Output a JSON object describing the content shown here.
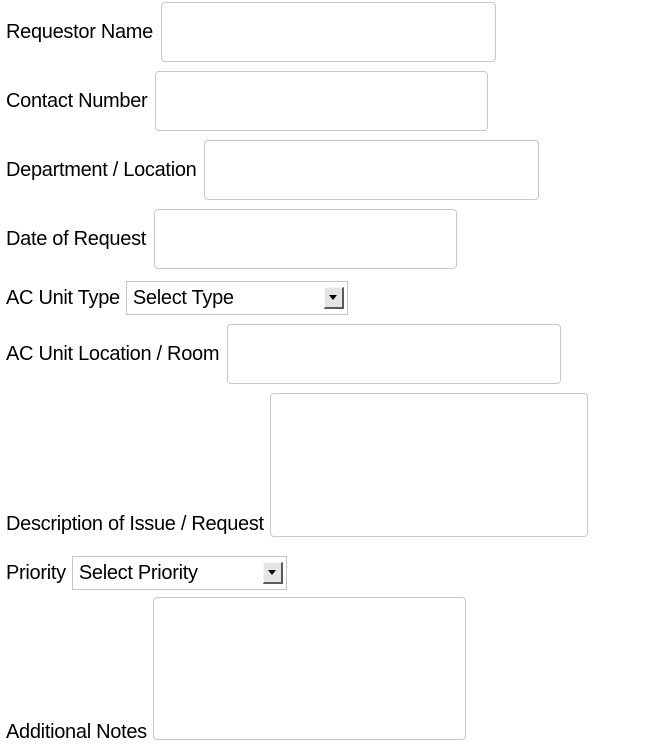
{
  "form": {
    "requestor_name": {
      "label": "Requestor Name",
      "value": ""
    },
    "contact_number": {
      "label": "Contact Number",
      "value": ""
    },
    "department_location": {
      "label": "Department / Location",
      "value": ""
    },
    "date_of_request": {
      "label": "Date of Request",
      "value": ""
    },
    "ac_unit_type": {
      "label": "AC Unit Type",
      "selected": "Select Type"
    },
    "ac_unit_location": {
      "label": "AC Unit Location / Room",
      "value": ""
    },
    "description": {
      "label": "Description of Issue / Request",
      "value": ""
    },
    "priority": {
      "label": "Priority",
      "selected": "Select Priority"
    },
    "additional_notes": {
      "label": "Additional Notes",
      "value": ""
    }
  },
  "icons": {
    "dropdown": "chevron-down-icon"
  },
  "colors": {
    "background": "#ffffff",
    "text": "#000000",
    "field_border": "#c8c8c8"
  }
}
